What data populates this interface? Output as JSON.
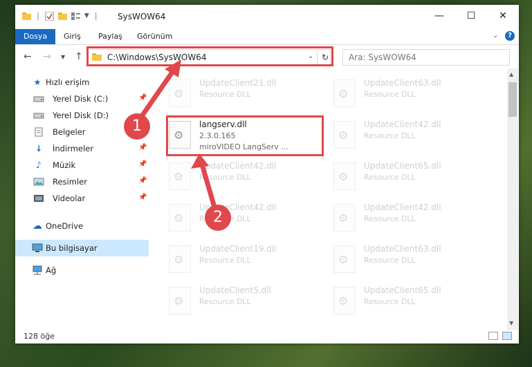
{
  "window": {
    "title": "SysWOW64"
  },
  "ribbon": {
    "tabs": [
      "Dosya",
      "Giriş",
      "Paylaş",
      "Görünüm"
    ]
  },
  "address": {
    "path": "C:\\Windows\\SysWOW64"
  },
  "search": {
    "placeholder": "Ara: SysWOW64"
  },
  "sidebar": {
    "items": [
      {
        "label": "Hızlı erişim",
        "icon": "star-icon"
      },
      {
        "label": "Yerel Disk (C:)",
        "icon": "drive-icon"
      },
      {
        "label": "Yerel Disk (D:)",
        "icon": "drive-icon"
      },
      {
        "label": "Belgeler",
        "icon": "documents-icon"
      },
      {
        "label": "İndirmeler",
        "icon": "download-icon"
      },
      {
        "label": "Müzik",
        "icon": "music-icon"
      },
      {
        "label": "Resimler",
        "icon": "pictures-icon"
      },
      {
        "label": "Videolar",
        "icon": "videos-icon"
      },
      {
        "label": "OneDrive",
        "icon": "cloud-icon"
      },
      {
        "label": "Bu bilgisayar",
        "icon": "computer-icon"
      },
      {
        "label": "Ağ",
        "icon": "network-icon"
      }
    ]
  },
  "files": {
    "left": [
      {
        "name": "UpdateClient21.dll",
        "sub": "Resource DLL"
      },
      {
        "name": "langserv.dll",
        "version": "2.3.0.165",
        "desc": "miroVIDEO LangServ ..."
      },
      {
        "name": "UpdateClient42.dll",
        "sub": "Resource DLL"
      },
      {
        "name": "UpdateClient42.dll",
        "sub": "Resource DLL"
      },
      {
        "name": "UpdateClient19.dll",
        "sub": "Resource DLL"
      },
      {
        "name": "UpdateClient5.dll",
        "sub": "Resource DLL"
      }
    ],
    "right": [
      {
        "name": "UpdateClient63.dll",
        "sub": "Resource DLL"
      },
      {
        "name": "UpdateClient42.dll",
        "sub": "Resource DLL"
      },
      {
        "name": "UpdateClient65.dll",
        "sub": "Resource DLL"
      },
      {
        "name": "UpdateClient42.dll",
        "sub": "Resource DLL"
      },
      {
        "name": "UpdateClient63.dll",
        "sub": "Resource DLL"
      },
      {
        "name": "UpdateClient65.dll",
        "sub": "Resource DLL"
      }
    ]
  },
  "status": {
    "count": "128 öğe"
  },
  "annotations": {
    "step1": "1",
    "step2": "2"
  },
  "colors": {
    "accent": "#1a6ac3",
    "highlight": "#e0484b",
    "selected": "#cce8ff"
  }
}
